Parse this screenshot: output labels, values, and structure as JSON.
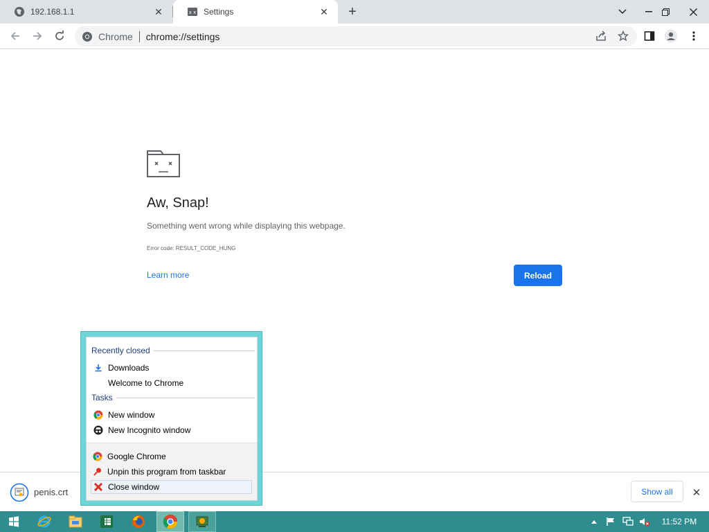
{
  "tabs": [
    {
      "title": "192.168.1.1",
      "icon": "globe-icon",
      "active": false
    },
    {
      "title": "Settings",
      "icon": "sad-tab-icon",
      "active": true
    }
  ],
  "omnibox": {
    "chip": "Chrome",
    "url": "chrome://settings"
  },
  "error": {
    "heading": "Aw, Snap!",
    "message": "Something went wrong while displaying this webpage.",
    "code": "Error code: RESULT_CODE_HUNG",
    "learn_more": "Learn more",
    "reload": "Reload"
  },
  "shelf": {
    "file_name": "penis.crt",
    "show_all": "Show all"
  },
  "jumplist": {
    "recently_closed_header": "Recently closed",
    "recent_items": [
      "Downloads",
      "Welcome to Chrome"
    ],
    "tasks_header": "Tasks",
    "task_items": [
      "New window",
      "New Incognito window"
    ],
    "app_items": [
      "Google Chrome",
      "Unpin this program from taskbar",
      "Close window"
    ]
  },
  "taskbar": {
    "clock": "11:52 PM"
  },
  "colors": {
    "accent": "#1a73e8",
    "taskbar": "#2f8d8f",
    "jumplist_frame": "#6ed6d8"
  }
}
